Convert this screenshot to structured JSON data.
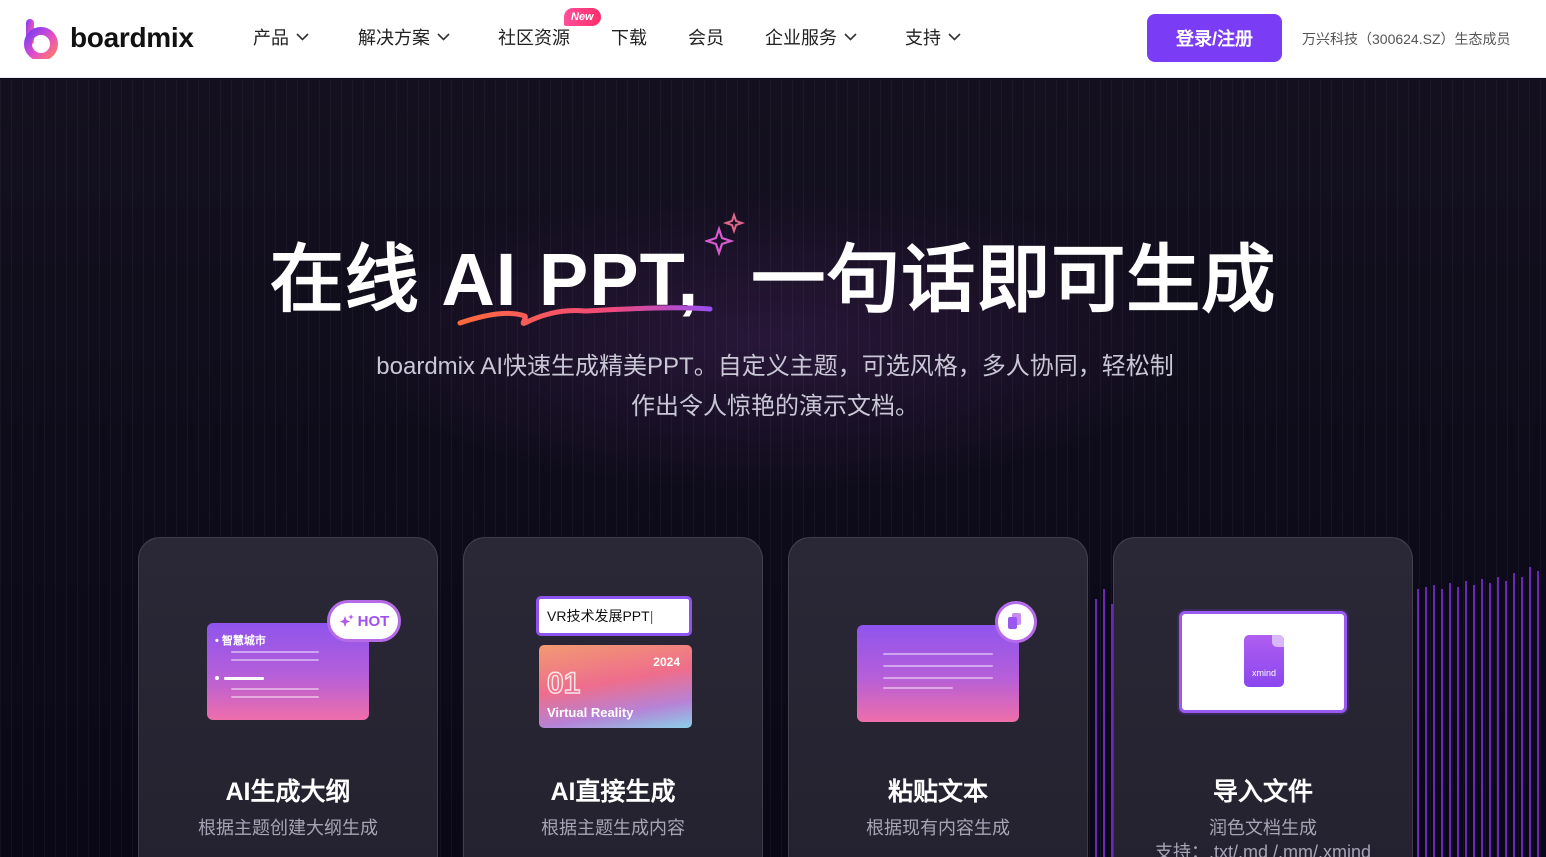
{
  "nav": {
    "logo_text": "boardmix",
    "items": [
      {
        "label": "产品",
        "has_dropdown": true
      },
      {
        "label": "解决方案",
        "has_dropdown": true
      },
      {
        "label": "社区资源",
        "has_dropdown": false
      },
      {
        "label": "下载",
        "has_dropdown": false
      },
      {
        "label": "会员",
        "has_dropdown": false
      },
      {
        "label": "企业服务",
        "has_dropdown": true
      },
      {
        "label": "支持",
        "has_dropdown": true
      }
    ],
    "new_badge": "New",
    "login_label": "登录/注册",
    "eco_text": "万兴科技（300624.SZ）生态成员"
  },
  "hero": {
    "title_part1": "在线 AI PPT,",
    "title_part2": "一句话即可生成",
    "subtitle_line1": "boardmix AI快速生成精美PPT。自定义主题，可选风格，多人协同，轻松制",
    "subtitle_line2": "作出令人惊艳的演示文档。"
  },
  "cards": [
    {
      "title": "AI生成大纲",
      "desc": "根据主题创建大纲生成",
      "slide_heading": "智慧城市",
      "badge": "HOT"
    },
    {
      "title": "AI直接生成",
      "desc": "根据主题生成内容",
      "input_text": "VR技术发展PPT",
      "cover_year": "2024",
      "cover_num": "01",
      "cover_label": "Virtual Reality"
    },
    {
      "title": "粘贴文本",
      "desc": "根据现有内容生成"
    },
    {
      "title": "导入文件",
      "desc": "润色文档生成",
      "formats": "支持：.txt/.md /.mm/.xmind",
      "file_label": "xmind"
    }
  ],
  "colors": {
    "brand": "#7b3cf5",
    "accent_pink": "#ff2d6b",
    "hero_bg": "#0c0a18"
  }
}
